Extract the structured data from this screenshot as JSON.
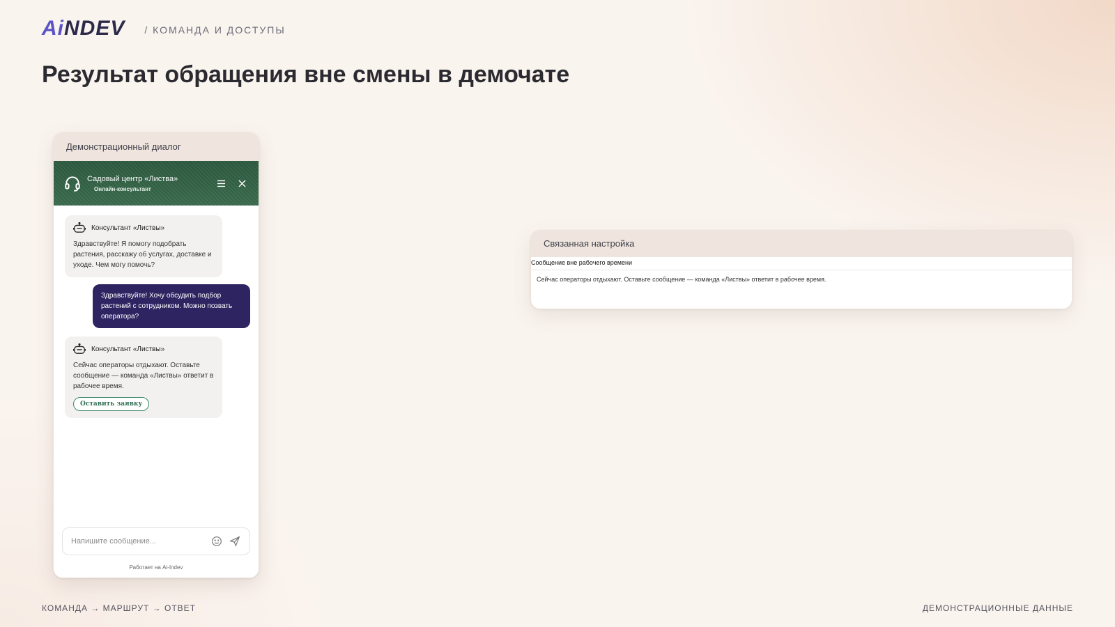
{
  "header": {
    "logo_ai": "Ai",
    "logo_rest": "NDEV",
    "section": "/ КОМАНДА И ДОСТУПЫ"
  },
  "page_title": "Результат обращения вне смены в демочате",
  "demo": {
    "card_title": "Демонстрационный диалог",
    "chat_title": "Садовый центр «Листва»",
    "chat_subtitle": "Онлайн-консультант",
    "messages": [
      {
        "from": "bot",
        "name": "Консультант «Листвы»",
        "text": "Здравствуйте! Я помогу подобрать растения, расскажу об услугах, доставке и уходе. Чем могу помочь?"
      },
      {
        "from": "user",
        "text": "Здравствуйте! Хочу обсудить подбор растений с сотрудником. Можно позвать оператора?"
      },
      {
        "from": "bot",
        "name": "Консультант «Листвы»",
        "text": "Сейчас операторы отдыхают. Оставьте сообщение — команда «Листвы» ответит в рабочее время.",
        "button": "Оставить заявку"
      }
    ],
    "input_placeholder": "Напишите сообщение...",
    "powered_by": "Работает на Ai-Indev"
  },
  "settings": {
    "card_title": "Связанная настройка",
    "field_label": "Сообщение вне рабочего времени",
    "field_value": "Сейчас операторы отдыхают. Оставьте сообщение — команда «Листвы» ответит в рабочее время."
  },
  "footer": {
    "left": "КОМАНДА → МАРШРУТ → ОТВЕТ",
    "right": "ДЕМОНСТРАЦИОННЫЕ ДАННЫЕ"
  },
  "colors": {
    "accent": "#5a53c8",
    "chat_header_green": "#2d5a40",
    "user_bubble": "#2e2461",
    "action_green": "#3f8a68"
  }
}
